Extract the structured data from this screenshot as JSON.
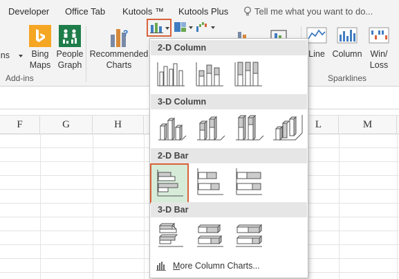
{
  "tabs": [
    {
      "label": "Developer"
    },
    {
      "label": "Office Tab"
    },
    {
      "label": "Kutools ™"
    },
    {
      "label": "Kutools Plus"
    }
  ],
  "tell_me": {
    "placeholder": "Tell me what you want to do..."
  },
  "ribbon": {
    "addins_partial": "ins",
    "bing_maps": {
      "line1": "Bing",
      "line2": "Maps"
    },
    "people_graph": {
      "line1": "People",
      "line2": "Graph"
    },
    "recommended": {
      "line1": "Recommended",
      "line2": "Charts"
    },
    "groups": {
      "addins": "Add-ins",
      "sparklines": "Sparklines"
    },
    "sparklines": [
      {
        "line1": "Line",
        "line2": ""
      },
      {
        "line1": "Column",
        "line2": ""
      },
      {
        "line1": "Win/",
        "line2": "Loss"
      }
    ]
  },
  "columns": [
    "F",
    "G",
    "H",
    "L",
    "M"
  ],
  "dropdown": {
    "sections": [
      "2-D Column",
      "3-D Column",
      "2-D Bar",
      "3-D Bar"
    ],
    "more_link": "More Column Charts...",
    "more_underline_letter": "M",
    "more_rest": "ore Column Charts..."
  },
  "colors": {
    "accent": "#d9623b",
    "selected_bg": "#d7ebd9",
    "bing": "#f5a623",
    "people_graph": "#1e7d4a"
  }
}
